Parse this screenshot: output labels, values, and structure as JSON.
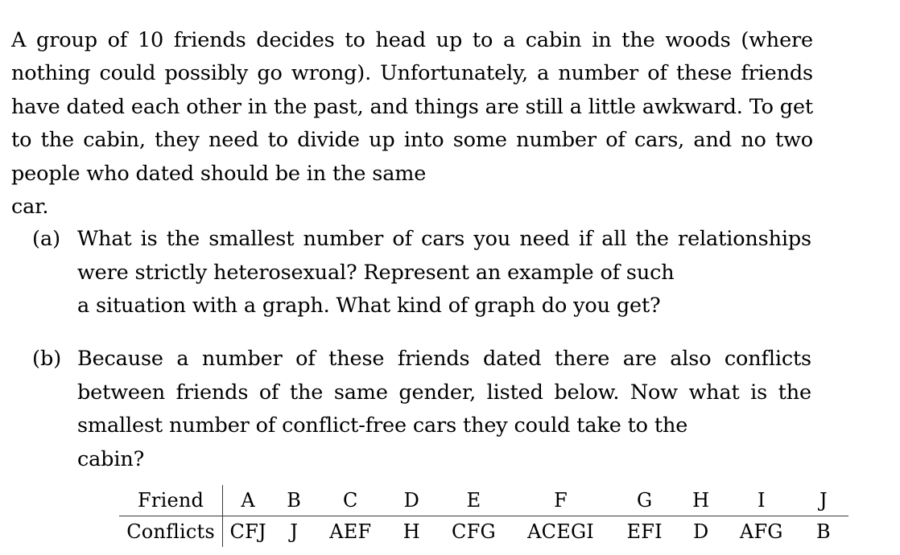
{
  "document": {
    "intro": {
      "text": "A group of 10 friends decides to head up to a cabin in the woods (where nothing could possibly go wrong).  Unfortunately, a number of these friends have dated each other in the past, and things are still a little awkward.  To get to the cabin, they need to divide up into some number of cars, and no two people who dated should be in the same",
      "last_line": "car."
    },
    "items": [
      {
        "label": "(a)",
        "text": "What is the smallest number of cars you need if all the relationships were strictly heterosexual?  Represent an example of such",
        "last_line": "a situation with a graph.  What kind of graph do you get?"
      },
      {
        "label": "(b)",
        "text": "Because a number of these friends dated there are also conflicts between friends of the same gender, listed below.  Now what is the smallest number of conflict-free cars they could take to the",
        "last_line": "cabin?"
      }
    ],
    "table": {
      "row_headers": [
        "Friend",
        "Conflicts"
      ],
      "friends": [
        "A",
        "B",
        "C",
        "D",
        "E",
        "F",
        "G",
        "H",
        "I",
        "J"
      ],
      "conflicts": [
        "CFJ",
        "J",
        "AEF",
        "H",
        "CFG",
        "ACEGI",
        "EFI",
        "D",
        "AFG",
        "B"
      ]
    }
  }
}
